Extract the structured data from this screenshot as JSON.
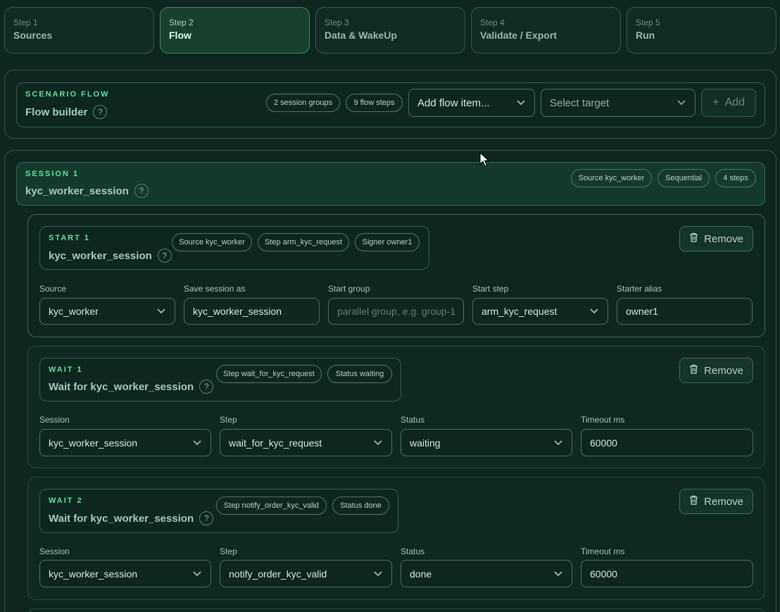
{
  "steps": [
    {
      "num": "Step 1",
      "label": "Sources"
    },
    {
      "num": "Step 2",
      "label": "Flow"
    },
    {
      "num": "Step 3",
      "label": "Data & WakeUp"
    },
    {
      "num": "Step 4",
      "label": "Validate / Export"
    },
    {
      "num": "Step 5",
      "label": "Run"
    }
  ],
  "scenario": {
    "eyebrow": "SCENARIO FLOW",
    "title": "Flow builder",
    "help": "?",
    "badges": [
      "2 session groups",
      "9 flow steps"
    ],
    "add_item_select": "Add flow item...",
    "target_select": "Select target",
    "add_button": "Add",
    "add_icon": "+"
  },
  "session": {
    "eyebrow": "SESSION 1",
    "title": "kyc_worker_session",
    "help": "?",
    "badges": [
      "Source kyc_worker",
      "Sequential",
      "4 steps"
    ]
  },
  "start": {
    "eyebrow": "START 1",
    "title": "kyc_worker_session",
    "help": "?",
    "badges": [
      "Source kyc_worker",
      "Step arm_kyc_request",
      "Signer owner1"
    ],
    "remove_label": "Remove",
    "labels": {
      "source": "Source",
      "save_as": "Save session as",
      "group": "Start group",
      "step": "Start step",
      "alias": "Starter alias"
    },
    "values": {
      "source": "kyc_worker",
      "save_as": "kyc_worker_session",
      "group_placeholder": "parallel group, e.g. group-1",
      "step": "arm_kyc_request",
      "alias": "owner1"
    }
  },
  "wait1": {
    "eyebrow": "WAIT 1",
    "title": "Wait for kyc_worker_session",
    "help": "?",
    "badges": [
      "Step wait_for_kyc_request",
      "Status waiting"
    ],
    "remove_label": "Remove",
    "labels": {
      "session": "Session",
      "step": "Step",
      "status": "Status",
      "timeout": "Timeout ms"
    },
    "values": {
      "session": "kyc_worker_session",
      "step": "wait_for_kyc_request",
      "status": "waiting",
      "timeout": "60000"
    }
  },
  "wait2": {
    "eyebrow": "WAIT 2",
    "title": "Wait for kyc_worker_session",
    "help": "?",
    "badges": [
      "Step notify_order_kyc_valid",
      "Status done"
    ],
    "remove_label": "Remove",
    "labels": {
      "session": "Session",
      "step": "Step",
      "status": "Status",
      "timeout": "Timeout ms"
    },
    "values": {
      "session": "kyc_worker_session",
      "step": "notify_order_kyc_valid",
      "status": "done",
      "timeout": "60000"
    }
  },
  "colors": {
    "accent": "#5ee3a0",
    "bg": "#0f2620",
    "active_step": "#17402f"
  }
}
